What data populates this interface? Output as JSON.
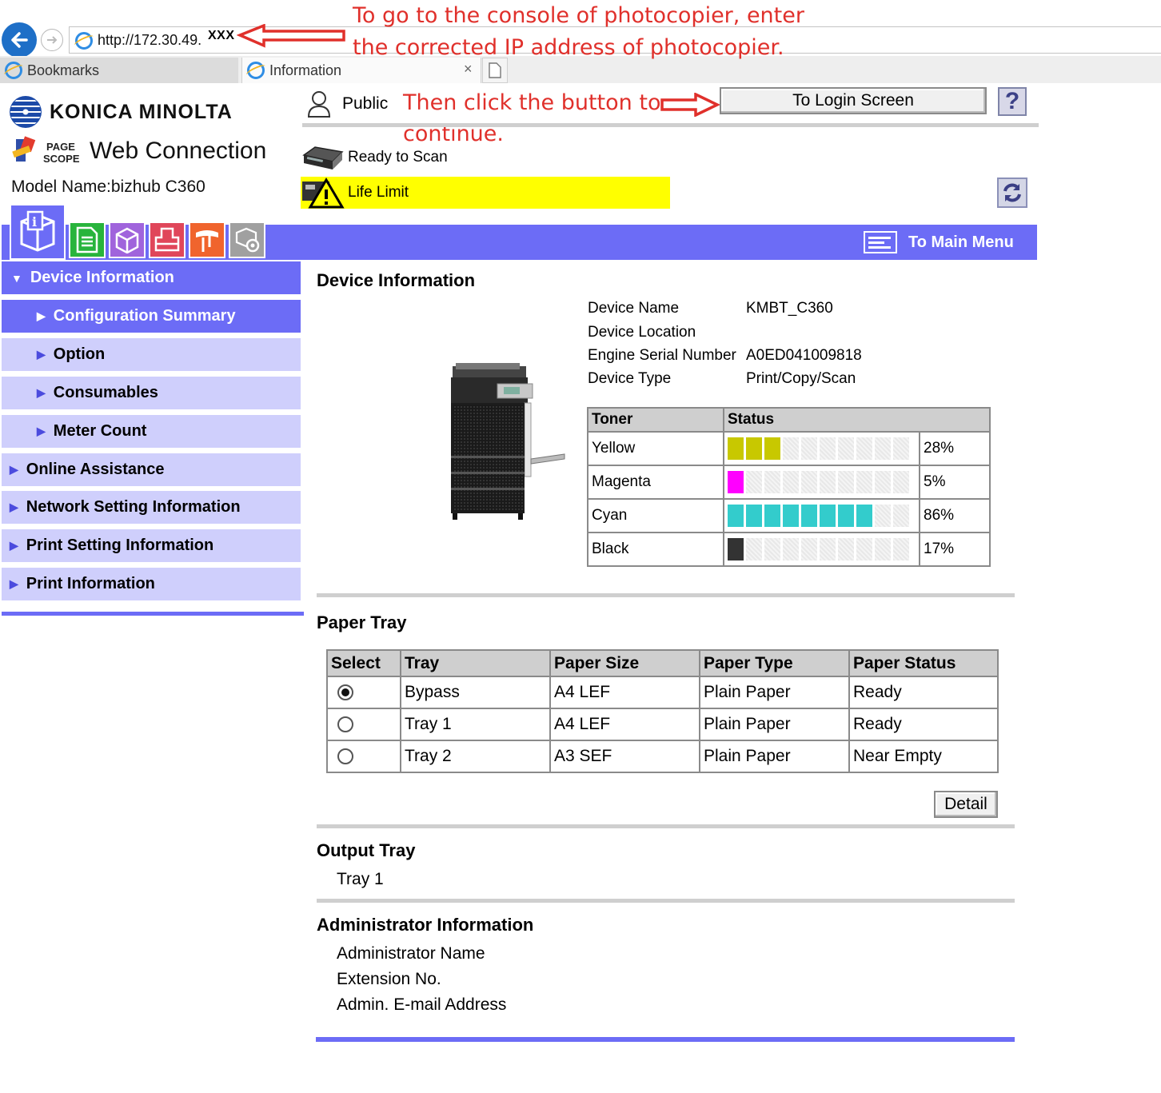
{
  "browser": {
    "url": "http://172.30.49.",
    "url_masked_suffix": "XXX",
    "tabs": [
      {
        "label": "Bookmarks"
      },
      {
        "label": "Information"
      }
    ],
    "close_glyph": "×"
  },
  "annotations": {
    "line1": "To go to the console of photocopier, enter",
    "line2": "the corrected IP address of photocopier.",
    "line3": "Then click the button to",
    "line4": "continue.",
    "color": "#e0302b"
  },
  "header": {
    "brand": "KONICA MINOLTA",
    "product": "Web Connection",
    "pagescope_line1": "PAGE",
    "pagescope_line2": "SCOPE",
    "model": "Model Name:bizhub C360",
    "user_mode": "Public",
    "login_button": "To Login Screen",
    "help_glyph": "?",
    "status_ready": "Ready to Scan",
    "status_warning": "Life Limit"
  },
  "nav": {
    "main_menu": "To Main Menu",
    "icon_tabs": [
      {
        "icon": "information-icon",
        "color": "#6c6cf6"
      },
      {
        "icon": "job-icon",
        "color": "#28b43c"
      },
      {
        "icon": "box-icon",
        "color": "#a064dc"
      },
      {
        "icon": "direct-print-icon",
        "color": "#e0465a"
      },
      {
        "icon": "store-address-icon",
        "color": "#f0642d"
      },
      {
        "icon": "settings-icon",
        "color": "#a0a0a0"
      }
    ],
    "sidebar": [
      {
        "label": "Device Information",
        "level": 0,
        "expanded": true
      },
      {
        "label": "Configuration Summary",
        "level": 1
      },
      {
        "label": "Option",
        "level": 1
      },
      {
        "label": "Consumables",
        "level": 1
      },
      {
        "label": "Meter Count",
        "level": 1
      },
      {
        "label": "Online Assistance",
        "level": 0
      },
      {
        "label": "Network Setting Information",
        "level": 0
      },
      {
        "label": "Print Setting Information",
        "level": 0
      },
      {
        "label": "Print Information",
        "level": 0
      }
    ]
  },
  "device_info": {
    "title": "Device Information",
    "fields": [
      {
        "label": "Device Name",
        "value": "KMBT_C360"
      },
      {
        "label": "Device Location",
        "value": ""
      },
      {
        "label": "Engine Serial Number",
        "value": "A0ED041009818"
      },
      {
        "label": "Device Type",
        "value": "Print/Copy/Scan"
      }
    ],
    "toner_header": "Toner",
    "status_header": "Status",
    "toners": [
      {
        "name": "Yellow",
        "percent": "28%",
        "level": 0.28,
        "color": "#c8c800"
      },
      {
        "name": "Magenta",
        "percent": "5%",
        "level": 0.05,
        "color": "#ff00ff"
      },
      {
        "name": "Cyan",
        "percent": "86%",
        "level": 0.86,
        "color": "#33cccc"
      },
      {
        "name": "Black",
        "percent": "17%",
        "level": 0.17,
        "color": "#333333"
      }
    ]
  },
  "paper_tray": {
    "title": "Paper Tray",
    "columns": [
      "Select",
      "Tray",
      "Paper Size",
      "Paper Type",
      "Paper Status"
    ],
    "rows": [
      {
        "selected": true,
        "tray": "Bypass",
        "size": "A4 LEF",
        "type": "Plain Paper",
        "status": "Ready"
      },
      {
        "selected": false,
        "tray": "Tray 1",
        "size": "A4 LEF",
        "type": "Plain Paper",
        "status": "Ready"
      },
      {
        "selected": false,
        "tray": "Tray 2",
        "size": "A3 SEF",
        "type": "Plain Paper",
        "status": "Near Empty"
      }
    ],
    "detail_button": "Detail"
  },
  "output_tray": {
    "title": "Output Tray",
    "value": "Tray 1"
  },
  "admin": {
    "title": "Administrator Information",
    "fields": [
      "Administrator Name",
      "Extension No.",
      "Admin. E-mail Address"
    ]
  }
}
